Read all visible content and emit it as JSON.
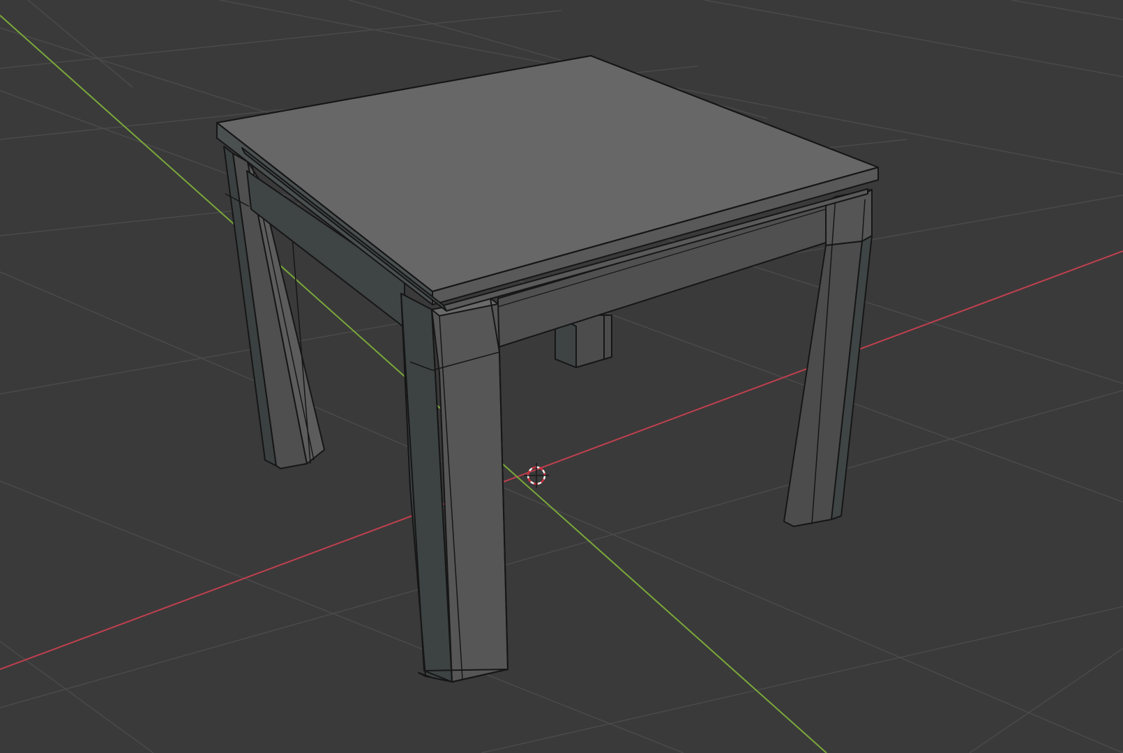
{
  "viewport": {
    "background": "#3a3a3a",
    "grid_color": "#4a4a4a",
    "x_axis_color": "#c0404e",
    "y_axis_color": "#7aa83a",
    "edge_color": "#161616",
    "cursor_colors": [
      "#d03040",
      "#f0f0f0"
    ]
  },
  "scene": {
    "object": "table",
    "tabletop_color": "#676767",
    "apron_color": "#4e4e4e",
    "leg_color": "#545454",
    "leg_shadow_color": "#3d4242"
  }
}
